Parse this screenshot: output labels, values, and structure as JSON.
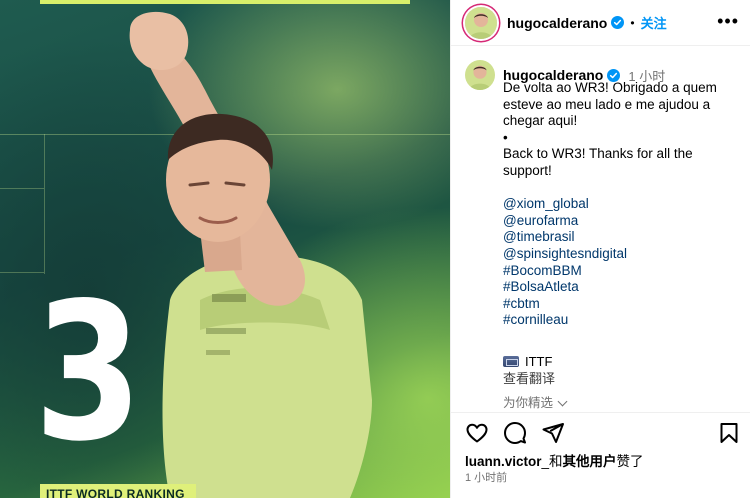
{
  "media": {
    "big_number": "3",
    "banner_text": "ITTF WORLD RANKING",
    "colors": {
      "banner": "#dff07a",
      "number": "#ffffff",
      "bg_dark": "#174a43",
      "bg_light": "#8cc94a"
    }
  },
  "header": {
    "username": "hugocalderano",
    "separator": "•",
    "follow_label": "关注",
    "more_label": "•••"
  },
  "post": {
    "username": "hugocalderano",
    "time": "1 小时",
    "caption_pt": "De volta ao WR3! Obrigado a quem esteve ao meu lado e me ajudou a chegar aqui!",
    "caption_sep": "•",
    "caption_en": "Back to WR3! Thanks for all the support!",
    "tags": [
      "@xiom_global",
      "@eurofarma",
      "@timebrasil",
      "@spinsightesndigital",
      "#BocomBBM",
      "#BolsaAtleta",
      "#cbtm",
      "#cornilleau"
    ],
    "org_label": "ITTF",
    "translate_label": "查看翻译",
    "related_label": "为你精选"
  },
  "actions": {
    "icons": [
      "heart-icon",
      "comment-icon",
      "share-icon",
      "save-icon"
    ]
  },
  "likes": {
    "user": "luann.victor",
    "connector": "_和",
    "others": "其他用户",
    "suffix": "赞了"
  },
  "timestamp": "1 小时前",
  "colors": {
    "link": "#00376b",
    "follow": "#0095f6",
    "muted": "#737373"
  }
}
